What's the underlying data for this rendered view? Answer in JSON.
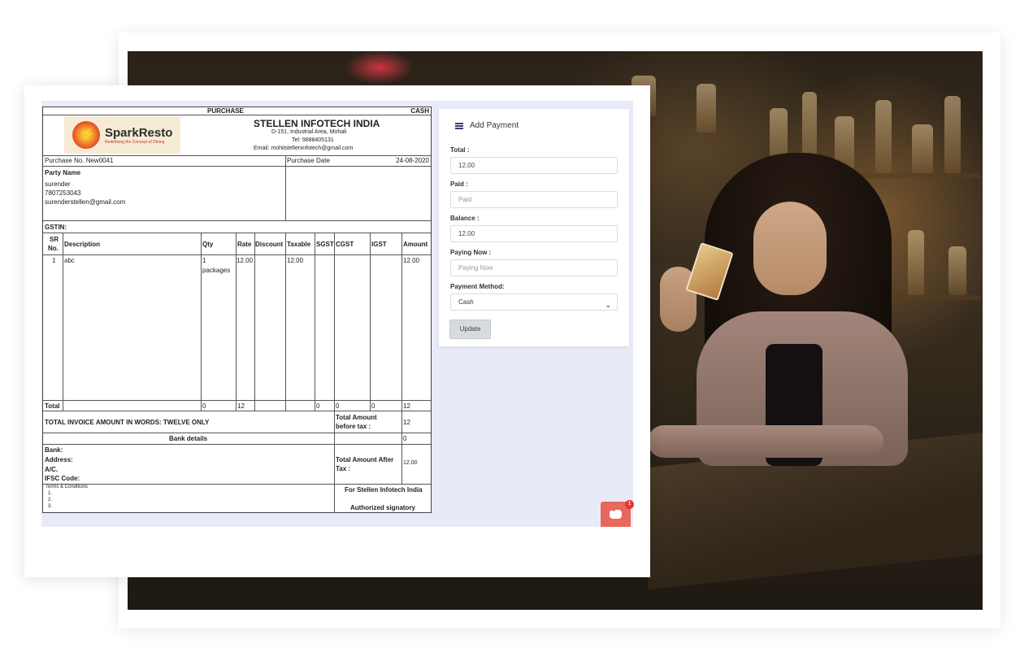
{
  "invoice": {
    "type_label": "PURCHASE",
    "mode_label": "CASH",
    "logo": {
      "name": "SparkResto",
      "tagline": "Redefining the Concept of Dining"
    },
    "company": {
      "name": "STELLEN INFOTECH INDIA",
      "address": "D-151, Industrial Area, Mohali",
      "tel": "Tel: 9888405131",
      "email": "Email: mohitstelleninfotech@gmail.com"
    },
    "purchase_no": "Purchase No. New0041",
    "purchase_date_label": "Purchase Date",
    "purchase_date": "24-08-2020",
    "party_label": "Party Name",
    "party_name": "surender",
    "party_phone": "7807253043",
    "party_email": "surenderstellen@gmail.com",
    "gstin_label": "GSTIN:",
    "columns": {
      "sr_line1": "SR",
      "sr_line2": "No.",
      "description": "Description",
      "qty": "Qty",
      "rate": "Rate",
      "discount": "Discount",
      "taxable": "Taxable",
      "sgst": "SGST",
      "cgst": "CGST",
      "igst": "IGST",
      "amount": "Amount"
    },
    "rows": [
      {
        "sr": "1",
        "description": "abc",
        "qty_line1": "1",
        "qty_line2": "packages",
        "rate": "12.00",
        "discount": "",
        "taxable": "12.00",
        "sgst": "",
        "cgst": "",
        "igst": "",
        "amount": "12.00"
      }
    ],
    "totals_row": {
      "label": "Total",
      "qty": "0",
      "rate": "12",
      "sgst": "0",
      "cgst": "0",
      "igst": "0",
      "amount": "12"
    },
    "amount_in_words": "TOTAL INVOICE AMOUNT IN WORDS: TWELVE ONLY",
    "total_before_tax_line1": "Total Amount",
    "total_before_tax_line2": "before tax :",
    "total_before_tax": "12",
    "bank_details_label": "Bank details",
    "bank_details_value": "0",
    "bank_label": "Bank:",
    "address_label": "Address:",
    "ac_label": "A/C.",
    "ifsc_label": "IFSC Code:",
    "total_after_tax_line1": "Total Amount After",
    "total_after_tax_line2": "Tax :",
    "total_after_tax": "12.00",
    "terms_label": "Terms & Conditions",
    "terms": [
      "1.",
      "2.",
      "3."
    ],
    "for_company": "For Stellen Infotech India",
    "signatory": "Authorized signatory"
  },
  "payment": {
    "title": "Add Payment",
    "total_label": "Total :",
    "total_value": "12.00",
    "paid_label": "Paid :",
    "paid_placeholder": "Paid",
    "balance_label": "Balance :",
    "balance_value": "12.00",
    "paying_now_label": "Paying Now :",
    "paying_now_placeholder": "Paying Now",
    "method_label": "Payment Method:",
    "method_value": "Cash",
    "update_label": "Update"
  },
  "chat": {
    "badge_count": "1"
  }
}
